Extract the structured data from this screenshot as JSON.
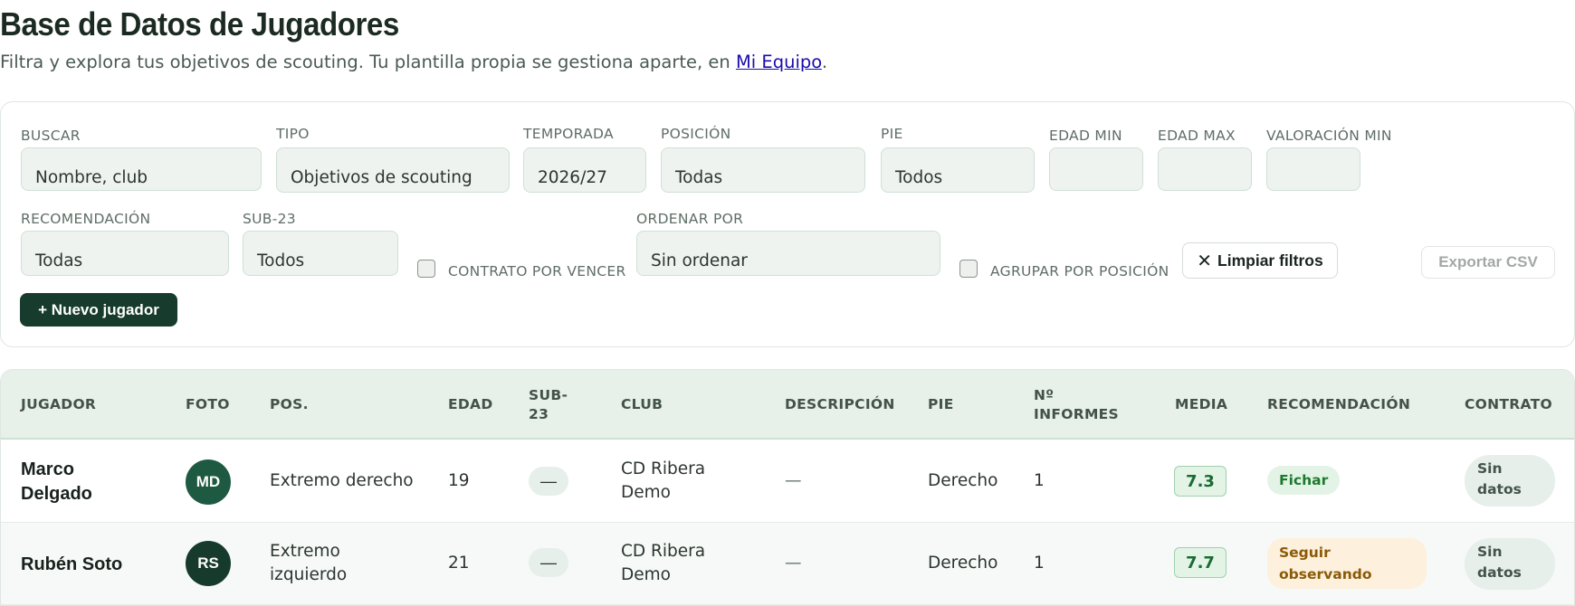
{
  "header": {
    "title": "Base de Datos de Jugadores",
    "subtitle_prefix": "Filtra y explora tus objetivos de scouting. Tu plantilla propia se gestiona aparte, en ",
    "subtitle_link": "Mi Equipo",
    "subtitle_suffix": "."
  },
  "filters": {
    "buscar": {
      "label": "BUSCAR",
      "placeholder": "Nombre, club"
    },
    "tipo": {
      "label": "TIPO",
      "value": "Objetivos de scouting"
    },
    "temporada": {
      "label": "TEMPORADA",
      "value": "2026/27"
    },
    "posicion": {
      "label": "POSICIÓN",
      "value": "Todas"
    },
    "pie": {
      "label": "PIE",
      "value": "Todos"
    },
    "edad_min": {
      "label": "EDAD MIN",
      "value": ""
    },
    "edad_max": {
      "label": "EDAD MAX",
      "value": ""
    },
    "valoracion_min": {
      "label": "VALORACIÓN MIN",
      "value": ""
    },
    "recomendacion": {
      "label": "RECOMENDACIÓN",
      "value": "Todas"
    },
    "sub23": {
      "label": "SUB-23",
      "value": "Todos"
    },
    "contrato_vencer": {
      "label": "CONTRATO POR VENCER",
      "checked": false
    },
    "ordenar": {
      "label": "ORDENAR POR",
      "value": "Sin ordenar"
    },
    "agrupar": {
      "label": "AGRUPAR POR POSICIÓN",
      "checked": false
    }
  },
  "actions": {
    "clear_icon": "close-icon",
    "clear_label": "Limpiar filtros",
    "export_label": "Exportar CSV",
    "new_label": "+ Nuevo jugador"
  },
  "table": {
    "headers": {
      "jugador": "JUGADOR",
      "foto": "FOTO",
      "pos": "POS.",
      "edad": "EDAD",
      "sub23_a": "SUB-",
      "sub23_b": "23",
      "club": "CLUB",
      "descripcion": "DESCRIPCIÓN",
      "pie": "PIE",
      "informes_a": "Nº",
      "informes_b": "INFORMES",
      "media": "MEDIA",
      "recomendacion": "RECOMENDACIÓN",
      "contrato": "CONTRATO"
    },
    "rows": [
      {
        "name_a": "Marco",
        "name_b": "Delgado",
        "initials": "MD",
        "avatar_color": "#1e5a42",
        "pos_a": "Extremo derecho",
        "pos_b": "",
        "edad": "19",
        "sub23": "—",
        "club_a": "CD Ribera",
        "club_b": "Demo",
        "descripcion": "—",
        "pie": "Derecho",
        "informes": "1",
        "media": "7.3",
        "recomendacion_a": "Fichar",
        "recomendacion_b": "",
        "recomendacion_color": "green",
        "contrato_a": "Sin",
        "contrato_b": "datos"
      },
      {
        "name_a": "Rubén Soto",
        "name_b": "",
        "initials": "RS",
        "avatar_color": "#163a2b",
        "pos_a": "Extremo",
        "pos_b": "izquierdo",
        "edad": "21",
        "sub23": "—",
        "club_a": "CD Ribera",
        "club_b": "Demo",
        "descripcion": "—",
        "pie": "Derecho",
        "informes": "1",
        "media": "7.7",
        "recomendacion_a": "Seguir",
        "recomendacion_b": "observando",
        "recomendacion_color": "amber",
        "contrato_a": "Sin",
        "contrato_b": "datos"
      }
    ]
  }
}
